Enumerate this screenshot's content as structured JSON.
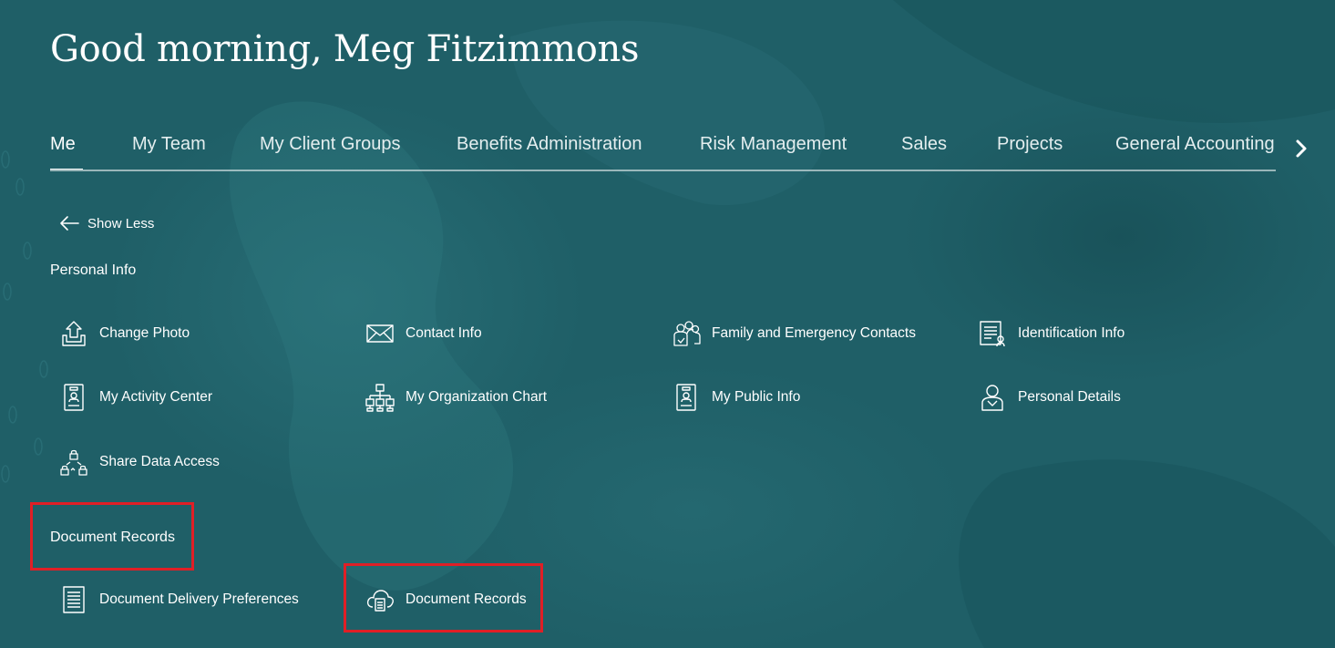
{
  "greeting": "Good morning, Meg Fitzimmons",
  "nav": {
    "tabs": [
      {
        "label": "Me",
        "active": true
      },
      {
        "label": "My Team",
        "active": false
      },
      {
        "label": "My Client Groups",
        "active": false
      },
      {
        "label": "Benefits Administration",
        "active": false
      },
      {
        "label": "Risk Management",
        "active": false
      },
      {
        "label": "Sales",
        "active": false
      },
      {
        "label": "Projects",
        "active": false
      },
      {
        "label": "General Accounting",
        "active": false
      }
    ],
    "next_icon": "chevron-right-icon"
  },
  "show_less": {
    "label": "Show Less",
    "icon": "arrow-left-icon"
  },
  "sections": {
    "personal_info": {
      "title": "Personal Info",
      "items": [
        {
          "label": "Change Photo",
          "icon": "upload-photo-icon"
        },
        {
          "label": "Contact Info",
          "icon": "envelope-icon"
        },
        {
          "label": "Family and Emergency Contacts",
          "icon": "family-icon"
        },
        {
          "label": "Identification Info",
          "icon": "id-document-icon"
        },
        {
          "label": "My Activity Center",
          "icon": "badge-icon"
        },
        {
          "label": "My Organization Chart",
          "icon": "org-chart-icon"
        },
        {
          "label": "My Public Info",
          "icon": "badge-icon"
        },
        {
          "label": "Personal Details",
          "icon": "person-icon"
        },
        {
          "label": "Share Data Access",
          "icon": "share-access-icon"
        }
      ]
    },
    "document_records": {
      "title": "Document Records",
      "items": [
        {
          "label": "Document Delivery Preferences",
          "icon": "document-list-icon"
        },
        {
          "label": "Document Records",
          "icon": "cloud-document-icon"
        }
      ]
    }
  },
  "colors": {
    "background": "#1f5f67",
    "text": "#ffffff",
    "highlight": "#e01f26"
  }
}
